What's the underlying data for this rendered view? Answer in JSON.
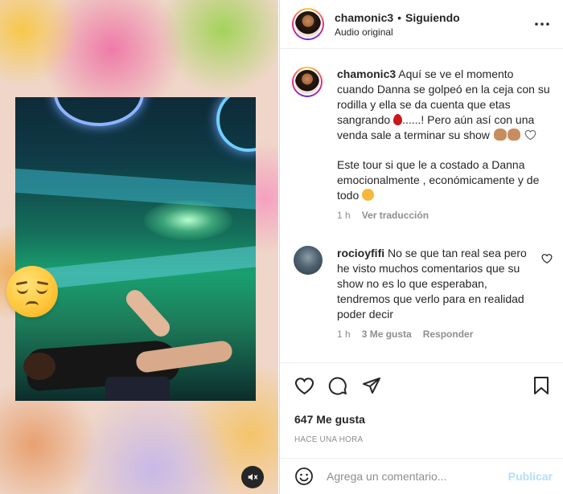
{
  "header": {
    "username": "chamonic3",
    "separator": "•",
    "follow_status": "Siguiendo",
    "audio": "Audio original",
    "more_icon": "more-horizontal-icon"
  },
  "caption": {
    "username": "chamonic3",
    "text_part1": "Aquí se ve el momento cuando Danna se golpeó en la ceja con su rodilla y ella se da cuenta que etas sangrando",
    "text_part2": "......! Pero aún así con una venda sale a terminar su show",
    "text_part3": "Este tour si que le a costado a Danna emocionalmente , económicamente y de todo",
    "time": "1 h",
    "see_translation": "Ver traducción"
  },
  "comments": [
    {
      "username": "rocioyfifi",
      "text": "No se que tan real sea pero he visto muchos comentarios que su show no es lo que esperaban, tendremos que verlo para en realidad poder decir",
      "time": "1 h",
      "likes": "3 Me gusta",
      "reply": "Responder"
    }
  ],
  "actions": {
    "likes_count": "647 Me gusta",
    "posted": "HACE UNA HORA"
  },
  "add_comment": {
    "placeholder": "Agrega un comentario...",
    "publish": "Publicar"
  },
  "colors": {
    "text": "#262626",
    "secondary": "#8e8e8e",
    "publish_disabled": "#b2dffc",
    "border": "#dbdbdb"
  }
}
